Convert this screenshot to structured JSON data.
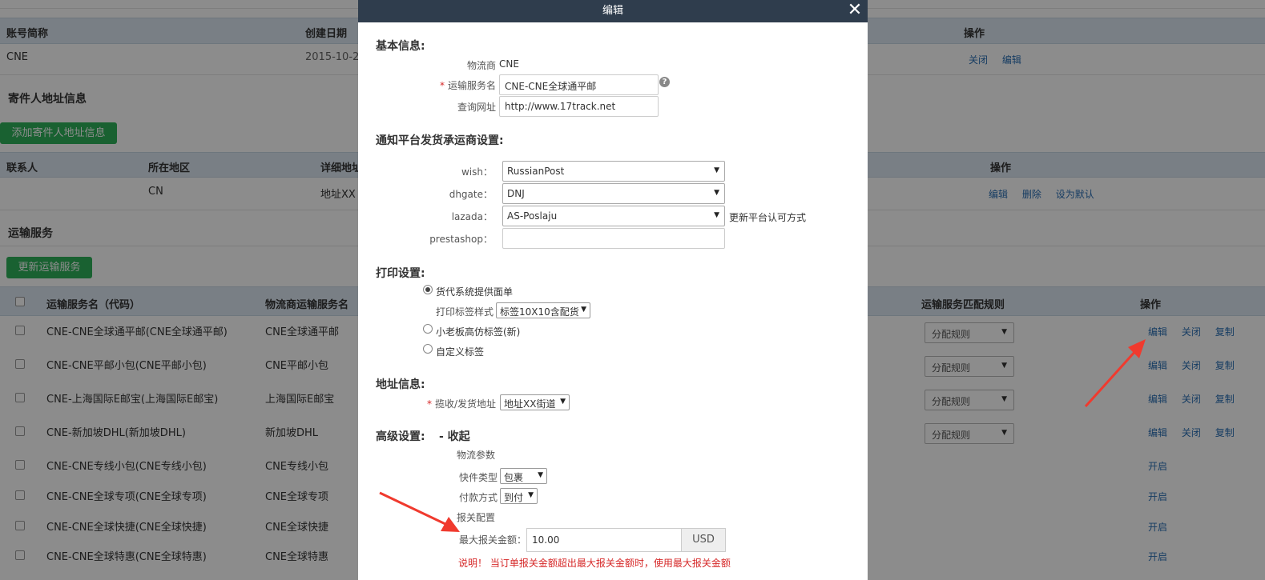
{
  "account_table": {
    "headers": [
      "账号简称",
      "创建日期",
      "操作"
    ],
    "row": {
      "name": "CNE",
      "date": "2015-10-2",
      "actions": [
        "关闭",
        "编辑"
      ]
    }
  },
  "sender_section": {
    "title": "寄件人地址信息",
    "add_button": "添加寄件人地址信息",
    "headers": [
      "联系人",
      "所在地区",
      "详细地址",
      "操作"
    ],
    "row": {
      "contact": "",
      "region": "CN",
      "address": "地址XX",
      "actions": [
        "编辑",
        "删除",
        "设为默认"
      ]
    }
  },
  "shipping_section": {
    "title": "运输服务",
    "update_button": "更新运输服务",
    "headers": [
      "运输服务名（代码）",
      "物流商运输服务名",
      "运输服务匹配规则",
      "操作"
    ],
    "rule_placeholder": "分配规则",
    "rows": [
      {
        "name": "CNE-CNE全球通平邮(CNE全球通平邮)",
        "carrier_name": "CNE全球通平邮",
        "has_rule": true,
        "actions": [
          "编辑",
          "关闭",
          "复制"
        ]
      },
      {
        "name": "CNE-CNE平邮小包(CNE平邮小包)",
        "carrier_name": "CNE平邮小包",
        "has_rule": true,
        "actions": [
          "编辑",
          "关闭",
          "复制"
        ]
      },
      {
        "name": "CNE-上海国际E邮宝(上海国际E邮宝)",
        "carrier_name": "上海国际E邮宝",
        "has_rule": true,
        "actions": [
          "编辑",
          "关闭",
          "复制"
        ]
      },
      {
        "name": "CNE-新加坡DHL(新加坡DHL)",
        "carrier_name": "新加坡DHL",
        "has_rule": true,
        "actions": [
          "编辑",
          "关闭",
          "复制"
        ]
      },
      {
        "name": "CNE-CNE专线小包(CNE专线小包)",
        "carrier_name": "CNE专线小包",
        "has_rule": false,
        "actions": [
          "开启"
        ]
      },
      {
        "name": "CNE-CNE全球专项(CNE全球专项)",
        "carrier_name": "CNE全球专项",
        "has_rule": false,
        "actions": [
          "开启"
        ]
      },
      {
        "name": "CNE-CNE全球快捷(CNE全球快捷)",
        "carrier_name": "CNE全球快捷",
        "has_rule": false,
        "actions": [
          "开启"
        ]
      },
      {
        "name": "CNE-CNE全球特惠(CNE全球特惠)",
        "carrier_name": "CNE全球特惠",
        "has_rule": false,
        "actions": [
          "开启"
        ]
      }
    ]
  },
  "modal": {
    "title": "编辑",
    "close_icon": "close-icon",
    "basic": {
      "title": "基本信息:",
      "carrier_label": "物流商",
      "carrier_value": "CNE",
      "required_mark": "*",
      "service_name_label": "运输服务名",
      "service_name_value": "CNE-CNE全球通平邮",
      "help_glyph": "?",
      "query_url_label": "查询网址",
      "query_url_value": "http://www.17track.net"
    },
    "platform": {
      "title": "通知平台发货承运商设置:",
      "wish_label": "wish：",
      "wish_value": "RussianPost",
      "dhgate_label": "dhgate：",
      "dhgate_value": "DNJ",
      "lazada_label": "lazada：",
      "lazada_value": "AS-Poslaju",
      "update_link": "更新平台认可方式",
      "prestashop_label": "prestashop：",
      "prestashop_value": ""
    },
    "print": {
      "title": "打印设置:",
      "option1": "货代系统提供面单",
      "label_style_label": "打印标签样式",
      "label_style_value": "标签10X10含配货",
      "option2": "小老板高仿标签(新)",
      "option3": "自定义标签"
    },
    "address": {
      "title": "地址信息:",
      "required_mark": "*",
      "label": "揽收/发货地址",
      "value": "地址XX街道"
    },
    "advanced": {
      "title": "高级设置:",
      "collapse_link": "- 收起",
      "logistics_params": "物流参数",
      "package_type_label": "快件类型",
      "package_type_value": "包裹",
      "payment_label": "付款方式",
      "payment_value": "到付",
      "customs_config": "报关配置",
      "max_declare_label": "最大报关金额：",
      "max_declare_value": "10.00",
      "currency": "USD",
      "note": "说明！ 当订单报关金额超出最大报关金额时，使用最大报关金额"
    }
  },
  "colors": {
    "header_bg": "#2f3d4d",
    "table_header_bg": "#dce7f2",
    "green": "#2fb15a",
    "link": "#2a6fb4",
    "annotation_arrow": "#f03a2e",
    "required": "#d62828"
  }
}
